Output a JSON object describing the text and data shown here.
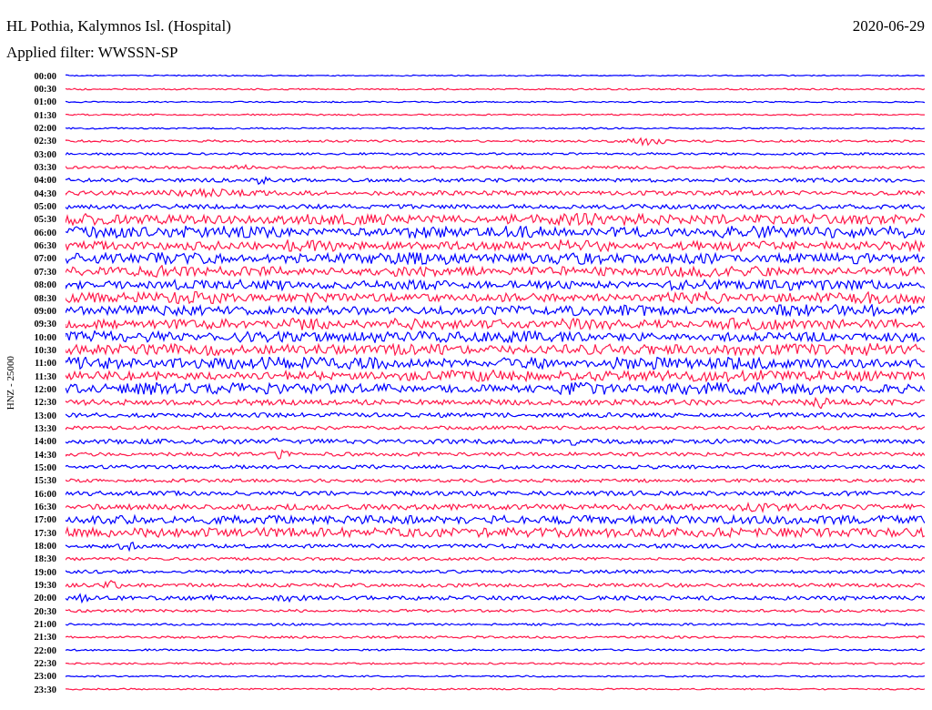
{
  "title": "HL Pothia, Kalymnos Isl. (Hospital)",
  "date": "2020-06-29",
  "filter": "Applied filter: WWSSN-SP",
  "axis_label": "HNZ - 25000",
  "traces": [
    {
      "time": "00:00",
      "color": "#0000ff"
    },
    {
      "time": "00:30",
      "color": "#ff1a4b"
    },
    {
      "time": "01:00",
      "color": "#0000ff"
    },
    {
      "time": "01:30",
      "color": "#ff1a4b"
    },
    {
      "time": "02:00",
      "color": "#0000ff"
    },
    {
      "time": "02:30",
      "color": "#ff1a4b"
    },
    {
      "time": "03:00",
      "color": "#0000ff"
    },
    {
      "time": "03:30",
      "color": "#ff1a4b"
    },
    {
      "time": "04:00",
      "color": "#0000ff"
    },
    {
      "time": "04:30",
      "color": "#ff1a4b"
    },
    {
      "time": "05:00",
      "color": "#0000ff"
    },
    {
      "time": "05:30",
      "color": "#ff1a4b"
    },
    {
      "time": "06:00",
      "color": "#0000ff"
    },
    {
      "time": "06:30",
      "color": "#ff1a4b"
    },
    {
      "time": "07:00",
      "color": "#0000ff"
    },
    {
      "time": "07:30",
      "color": "#ff1a4b"
    },
    {
      "time": "08:00",
      "color": "#0000ff"
    },
    {
      "time": "08:30",
      "color": "#ff1a4b"
    },
    {
      "time": "09:00",
      "color": "#0000ff"
    },
    {
      "time": "09:30",
      "color": "#ff1a4b"
    },
    {
      "time": "10:00",
      "color": "#0000ff"
    },
    {
      "time": "10:30",
      "color": "#ff1a4b"
    },
    {
      "time": "11:00",
      "color": "#0000ff"
    },
    {
      "time": "11:30",
      "color": "#ff1a4b"
    },
    {
      "time": "12:00",
      "color": "#0000ff"
    },
    {
      "time": "12:30",
      "color": "#ff1a4b"
    },
    {
      "time": "13:00",
      "color": "#0000ff"
    },
    {
      "time": "13:30",
      "color": "#ff1a4b"
    },
    {
      "time": "14:00",
      "color": "#0000ff"
    },
    {
      "time": "14:30",
      "color": "#ff1a4b"
    },
    {
      "time": "15:00",
      "color": "#0000ff"
    },
    {
      "time": "15:30",
      "color": "#ff1a4b"
    },
    {
      "time": "16:00",
      "color": "#0000ff"
    },
    {
      "time": "16:30",
      "color": "#ff1a4b"
    },
    {
      "time": "17:00",
      "color": "#0000ff"
    },
    {
      "time": "17:30",
      "color": "#ff1a4b"
    },
    {
      "time": "18:00",
      "color": "#0000ff"
    },
    {
      "time": "18:30",
      "color": "#ff1a4b"
    },
    {
      "time": "19:00",
      "color": "#0000ff"
    },
    {
      "time": "19:30",
      "color": "#ff1a4b"
    },
    {
      "time": "20:00",
      "color": "#0000ff"
    },
    {
      "time": "20:30",
      "color": "#ff1a4b"
    },
    {
      "time": "21:00",
      "color": "#0000ff"
    },
    {
      "time": "21:30",
      "color": "#ff1a4b"
    },
    {
      "time": "22:00",
      "color": "#0000ff"
    },
    {
      "time": "22:30",
      "color": "#ff1a4b"
    },
    {
      "time": "23:00",
      "color": "#0000ff"
    },
    {
      "time": "23:30",
      "color": "#ff1a4b"
    }
  ]
}
